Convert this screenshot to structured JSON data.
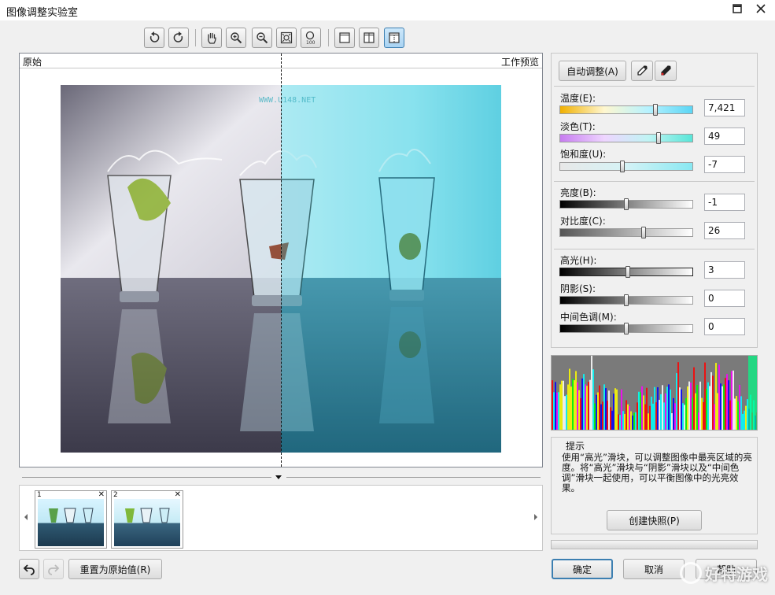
{
  "window": {
    "title": "图像调整实验室",
    "maximize_icon": "maximize-icon",
    "close_icon": "close-icon"
  },
  "preview": {
    "left_label": "原始",
    "right_label": "工作预览"
  },
  "controls": {
    "auto_adjust": "自动调整(A)",
    "sliders": [
      {
        "label": "温度(E):",
        "value": "7,421",
        "level": 0.72
      },
      {
        "label": "淡色(T):",
        "value": "49",
        "level": 0.74
      },
      {
        "label": "饱和度(U):",
        "value": "-7",
        "level": 0.47
      },
      {
        "label": "亮度(B):",
        "value": "-1",
        "level": 0.5
      },
      {
        "label": "对比度(C):",
        "value": "26",
        "level": 0.63
      },
      {
        "label": "高光(H):",
        "value": "3",
        "level": 0.51
      },
      {
        "label": "阴影(S):",
        "value": "0",
        "level": 0.5
      },
      {
        "label": "中间色调(M):",
        "value": "0",
        "level": 0.5
      }
    ]
  },
  "hint": {
    "title": "提示",
    "text": "使用“高光”滑块，可以调整图像中最亮区域的亮度。将“高光”滑块与“阴影”滑块以及“中间色调”滑块一起使用，可以平衡图像中的光亮效果。",
    "snapshot_button": "创建快照(P)"
  },
  "snapshots": [
    {
      "number": "1"
    },
    {
      "number": "2"
    }
  ],
  "footer": {
    "reset": "重置为原始值(R)",
    "ok": "确定",
    "cancel": "取消",
    "help": "帮助"
  },
  "watermark": "好特游戏",
  "photo_watermark": "WWW.U148.NET"
}
